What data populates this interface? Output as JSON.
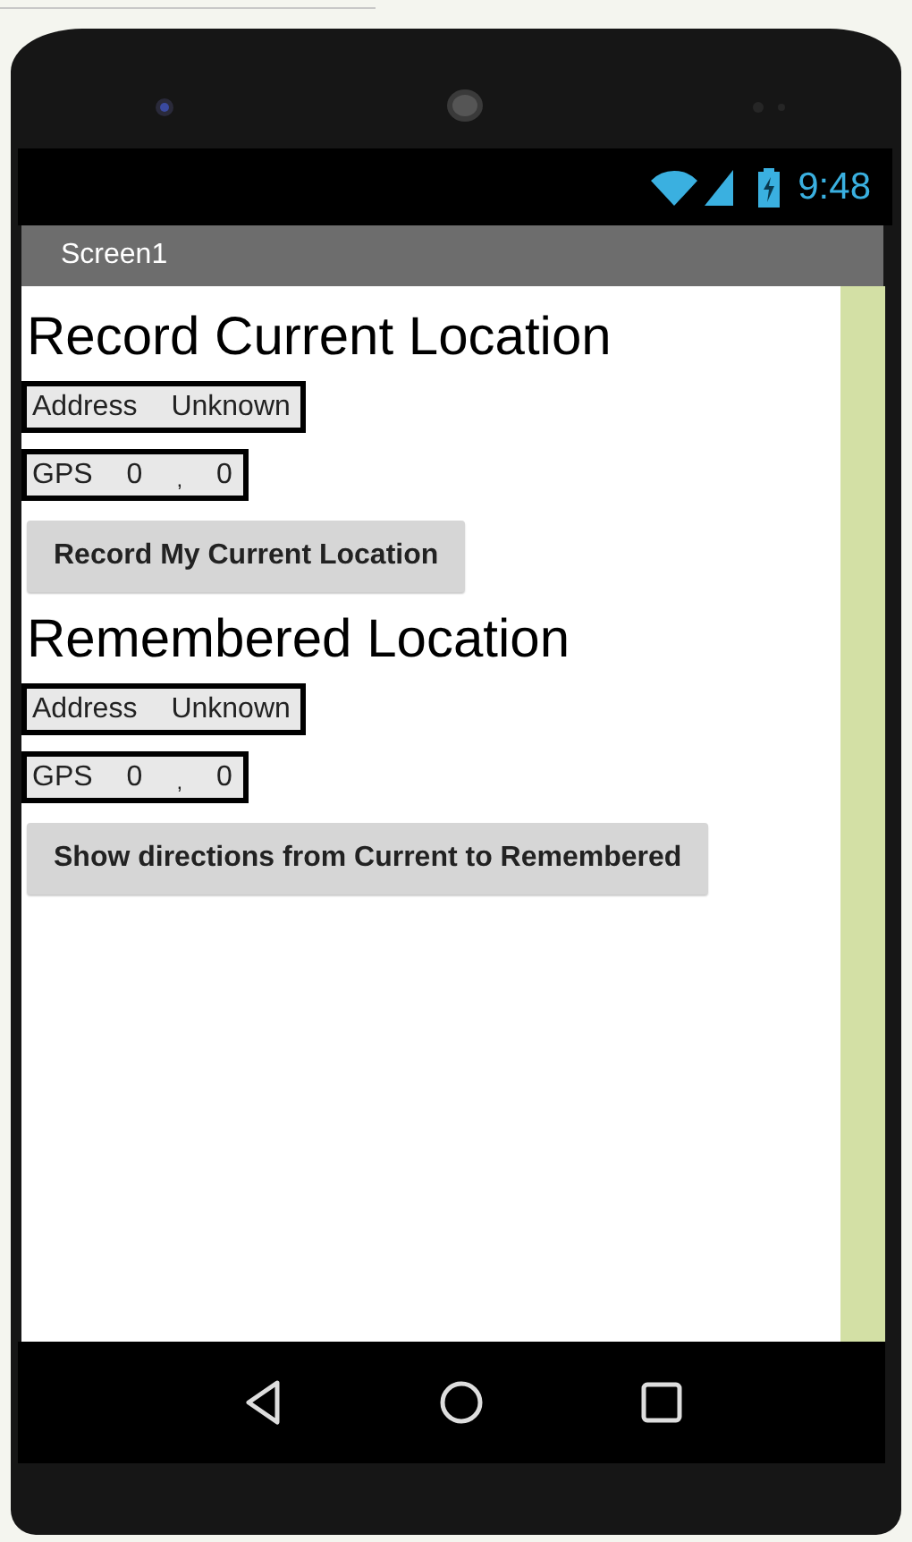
{
  "status_bar": {
    "time": "9:48"
  },
  "title_bar": {
    "title": "Screen1"
  },
  "sections": [
    {
      "heading": "Record Current Location",
      "address": {
        "label": "Address",
        "value": "Unknown"
      },
      "gps": {
        "label": "GPS",
        "latitude": "0",
        "separator": ",",
        "longitude": "0"
      },
      "button": "Record My Current Location"
    },
    {
      "heading": "Remembered Location",
      "address": {
        "label": "Address",
        "value": "Unknown"
      },
      "gps": {
        "label": "GPS",
        "latitude": "0",
        "separator": ",",
        "longitude": "0"
      },
      "button": "Show directions from Current to Remembered"
    }
  ]
}
